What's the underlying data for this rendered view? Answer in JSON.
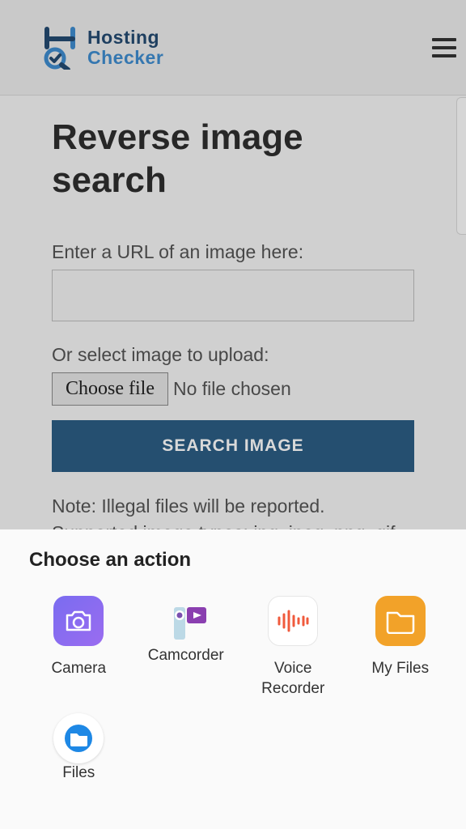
{
  "header": {
    "logo_line1": "Hosting",
    "logo_line2": "Checker"
  },
  "page": {
    "title": "Reverse image search",
    "url_label": "Enter a URL of an image here:",
    "url_value": "",
    "upload_label": "Or select image to upload:",
    "choose_file_btn": "Choose file",
    "no_file_text": "No file chosen",
    "search_btn": "SEARCH IMAGE",
    "note_line1": "Note: Illegal files will be reported.",
    "note_line2": "Supported image types: jpg, jpeg, png, gif"
  },
  "sheet": {
    "title": "Choose an action",
    "apps": {
      "camera": "Camera",
      "camcorder": "Camcorder",
      "voice": "Voice Recorder",
      "myfiles": "My Files",
      "files": "Files"
    }
  }
}
